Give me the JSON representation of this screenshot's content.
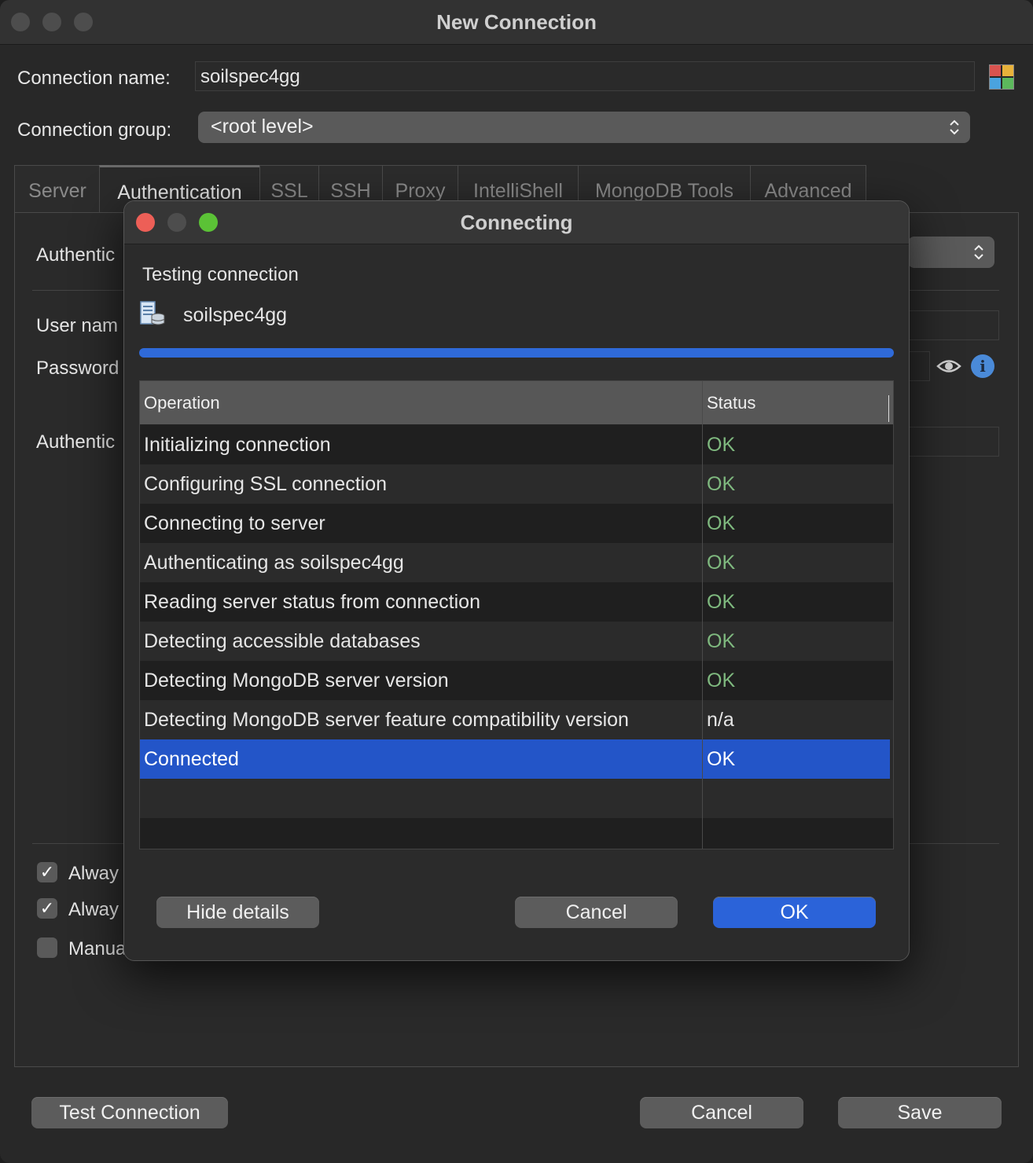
{
  "window": {
    "title": "New Connection",
    "connection_name_label": "Connection name:",
    "connection_name_value": "soilspec4gg",
    "connection_group_label": "Connection group:",
    "connection_group_value": "<root level>",
    "tabs": [
      "Server",
      "Authentication",
      "SSL",
      "SSH",
      "Proxy",
      "IntelliShell",
      "MongoDB Tools",
      "Advanced"
    ],
    "active_tab": "Authentication",
    "auth_labels": {
      "authentication_mode": "Authentic",
      "user_name": "User nam",
      "password": "Password",
      "authentication_db": "Authentic"
    },
    "checkboxes": [
      {
        "label": "Alway",
        "checked": true
      },
      {
        "label": "Alway",
        "checked": true
      },
      {
        "label": "Manua",
        "checked": false
      }
    ],
    "buttons": {
      "test_connection": "Test Connection",
      "cancel": "Cancel",
      "save": "Save"
    }
  },
  "dialog": {
    "title": "Connecting",
    "heading": "Testing connection",
    "connection_name": "soilspec4gg",
    "progress_percent": 100,
    "columns": [
      "Operation",
      "Status"
    ],
    "rows": [
      {
        "operation": "Initializing connection",
        "status": "OK"
      },
      {
        "operation": "Configuring SSL connection",
        "status": "OK"
      },
      {
        "operation": "Connecting to server",
        "status": "OK"
      },
      {
        "operation": "Authenticating as soilspec4gg",
        "status": "OK"
      },
      {
        "operation": "Reading server status from connection",
        "status": "OK"
      },
      {
        "operation": "Detecting accessible databases",
        "status": "OK"
      },
      {
        "operation": "Detecting MongoDB server version",
        "status": "OK"
      },
      {
        "operation": "Detecting MongoDB server feature compatibility version",
        "status": "n/a"
      },
      {
        "operation": "Connected",
        "status": "OK"
      }
    ],
    "selected_row": 8,
    "buttons": {
      "hide_details": "Hide details",
      "cancel": "Cancel",
      "ok": "OK"
    }
  },
  "colors": {
    "accent": "#2b63d9",
    "ok_status": "#7fb97f",
    "selection": "#2355c8"
  },
  "icons": {
    "color_picker": "color-grid-icon",
    "select_arrows": "updown-chevron-icon",
    "show_password": "eye-icon",
    "info": "info-icon",
    "connection": "database-server-icon"
  }
}
